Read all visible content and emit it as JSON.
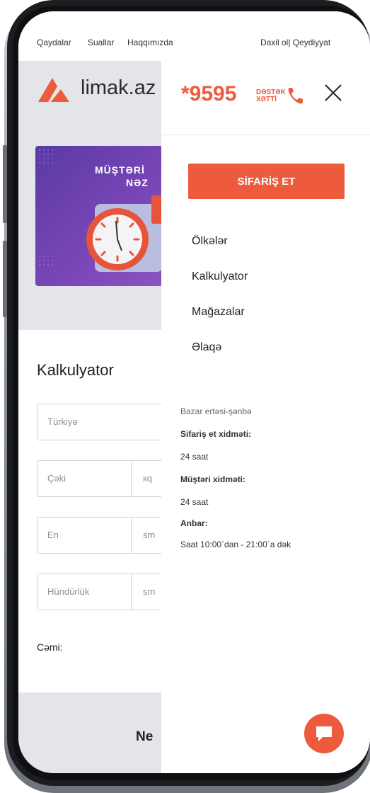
{
  "topbar": {
    "links": [
      "Qaydalar",
      "Suallar",
      "Haqqımızda"
    ],
    "auth": "Daxil ol| Qeydiyyat"
  },
  "header": {
    "logo_text": "limak.az"
  },
  "banner": {
    "line1": "MÜŞTƏRİ",
    "line2": "NƏZ"
  },
  "calculator": {
    "title": "Kalkulyator",
    "country_placeholder": "Türkiyə",
    "weight_placeholder": "Çəki",
    "weight_unit": "кq",
    "width_placeholder": "En",
    "width_unit": "sm",
    "height_placeholder": "Hündürlük",
    "height_unit": "sm",
    "total_label": "Cəmi:"
  },
  "footer": {
    "partial_text": "Ne"
  },
  "drawer": {
    "phone": "*9595",
    "support_line1": "DƏSTƏK",
    "support_line2": "XƏTTİ",
    "order_button": "SİFARİŞ ET",
    "menu": [
      "Ölkələr",
      "Kalkulyator",
      "Mağazalar",
      "Əlaqə"
    ],
    "hours": {
      "days": "Bazar ertəsi-şənbə",
      "order_label": "Sifariş et xidməti:",
      "order_value": "24 saat",
      "customer_label": "Müştəri xidməti:",
      "customer_value": "24 saat",
      "warehouse_label": "Anbar:",
      "warehouse_value": "Saat 10:00`dan - 21:00`a dək"
    }
  },
  "colors": {
    "accent": "#ee5a3c",
    "banner": "#6a40b0",
    "background": "#e4e5e9"
  },
  "icons": {
    "close": "close-icon",
    "chat": "chat-icon",
    "phone": "phone-icon",
    "logo": "logo-icon"
  }
}
